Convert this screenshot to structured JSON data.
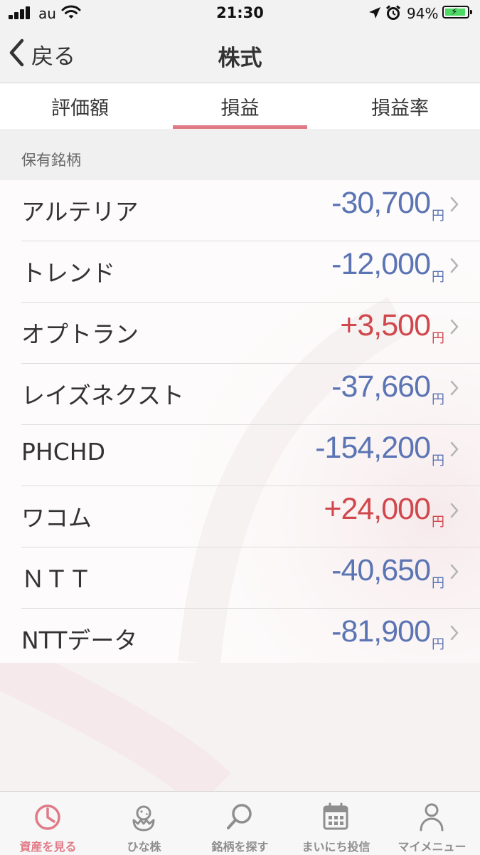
{
  "status_bar": {
    "carrier": "au",
    "time": "21:30",
    "battery_percent": "94%",
    "battery_level": 0.94
  },
  "nav": {
    "back_label": "戻る",
    "title": "株式"
  },
  "tabs": [
    {
      "label": "評価額",
      "active": false
    },
    {
      "label": "損益",
      "active": true
    },
    {
      "label": "損益率",
      "active": false
    }
  ],
  "section": {
    "label": "保有銘柄"
  },
  "holdings": [
    {
      "name": "アルテリア",
      "value": "-30,700",
      "unit": "円",
      "sign": "negative"
    },
    {
      "name": "トレンド",
      "value": "-12,000",
      "unit": "円",
      "sign": "negative"
    },
    {
      "name": "オプトラン",
      "value": "+3,500",
      "unit": "円",
      "sign": "positive"
    },
    {
      "name": "レイズネクスト",
      "value": "-37,660",
      "unit": "円",
      "sign": "negative"
    },
    {
      "name": "PHCHD",
      "value": "-154,200",
      "unit": "円",
      "sign": "negative"
    },
    {
      "name": "ワコム",
      "value": "+24,000",
      "unit": "円",
      "sign": "positive"
    },
    {
      "name": "ＮＴＴ",
      "value": "-40,650",
      "unit": "円",
      "sign": "negative"
    },
    {
      "name": "NTTデータ",
      "value": "-81,900",
      "unit": "円",
      "sign": "negative"
    }
  ],
  "tab_bar": [
    {
      "label": "資産を見る",
      "icon": "pie-chart-icon",
      "active": true
    },
    {
      "label": "ひな株",
      "icon": "chick-icon",
      "active": false
    },
    {
      "label": "銘柄を探す",
      "icon": "search-icon",
      "active": false
    },
    {
      "label": "まいにち投信",
      "icon": "calendar-icon",
      "active": false
    },
    {
      "label": "マイメニュー",
      "icon": "person-icon",
      "active": false
    }
  ],
  "colors": {
    "accent": "#e07a87",
    "negative": "#5b74b3",
    "positive": "#d0474c",
    "inactive": "#8e8e8e"
  }
}
